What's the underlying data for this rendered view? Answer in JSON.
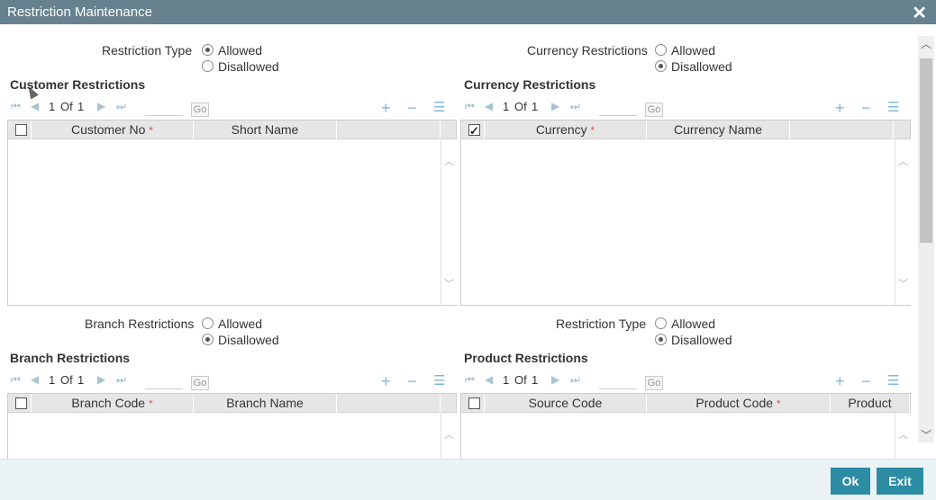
{
  "window": {
    "title": "Restriction Maintenance",
    "close_icon": "close-icon"
  },
  "restriction_type_top": {
    "label": "Restriction Type",
    "options": [
      "Allowed",
      "Disallowed"
    ],
    "selected": "Allowed"
  },
  "currency_restrictions_top": {
    "label": "Currency Restrictions",
    "options": [
      "Allowed",
      "Disallowed"
    ],
    "selected": "Disallowed"
  },
  "customer": {
    "section_title": "Customer Restrictions",
    "pager": {
      "page_current": "1",
      "of_label": "Of",
      "page_total": "1",
      "go_label": "Go"
    },
    "columns": [
      "Customer No",
      "Short Name"
    ],
    "required_marker": "*",
    "select_all_checked": false
  },
  "currency": {
    "section_title": "Currency Restrictions",
    "pager": {
      "page_current": "1",
      "of_label": "Of",
      "page_total": "1",
      "go_label": "Go"
    },
    "columns": [
      "Currency",
      "Currency Name"
    ],
    "required_marker": "*",
    "select_all_checked": true
  },
  "branch_restrictions_radio": {
    "label": "Branch Restrictions",
    "options": [
      "Allowed",
      "Disallowed"
    ],
    "selected": "Disallowed"
  },
  "restriction_type_bottom": {
    "label": "Restriction Type",
    "options": [
      "Allowed",
      "Disallowed"
    ],
    "selected": "Disallowed"
  },
  "branch": {
    "section_title": "Branch Restrictions",
    "pager": {
      "page_current": "1",
      "of_label": "Of",
      "page_total": "1",
      "go_label": "Go"
    },
    "columns": [
      "Branch Code",
      "Branch Name"
    ],
    "required_marker": "*"
  },
  "product": {
    "section_title": "Product Restrictions",
    "pager": {
      "page_current": "1",
      "of_label": "Of",
      "page_total": "1",
      "go_label": "Go"
    },
    "columns": [
      "Source Code",
      "Product Code",
      "Product"
    ],
    "required_marker": "*"
  },
  "footer": {
    "ok_label": "Ok",
    "exit_label": "Exit"
  },
  "colors": {
    "titlebar": "#66828e",
    "accent_button": "#2c8ca4",
    "grid_header": "#e6e6e6",
    "required": "#d9534f"
  }
}
